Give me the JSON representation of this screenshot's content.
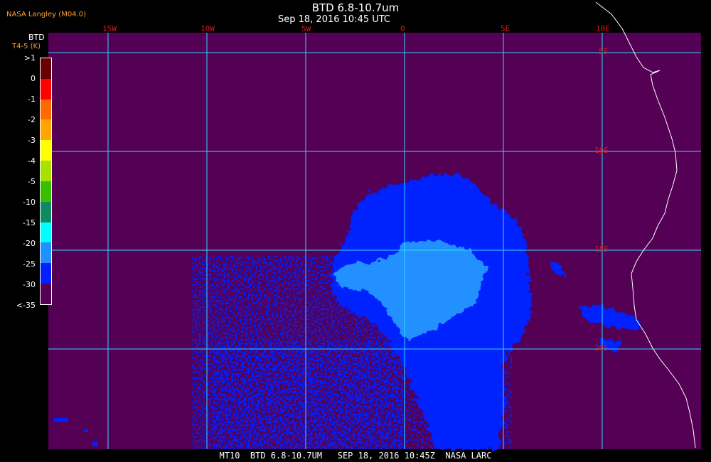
{
  "header": {
    "title": "BTD 6.8-10.7um",
    "subtitle": "Sep 18, 2016 10:45 UTC",
    "org": "NASA Langley (M04.0)"
  },
  "colorbar": {
    "title": "BTD",
    "units": "T4-5 (K)",
    "labels": [
      ">1",
      "0",
      "-1",
      "-2",
      "-3",
      "-4",
      "-5",
      "-10",
      "-15",
      "-20",
      "-25",
      "-30",
      "<-35"
    ],
    "colors": [
      "#6b0000",
      "#ff0000",
      "#ff6a00",
      "#ffa500",
      "#ffff00",
      "#a8e000",
      "#38c000",
      "#108a60",
      "#00ffff",
      "#2090ff",
      "#0020ff",
      "#540054"
    ]
  },
  "map": {
    "background_color": "#540054",
    "grid_color": "#33d6ff",
    "coast_color": "#ffffff",
    "lon_labels": [
      "15W",
      "10W",
      "5W",
      "0",
      "5E",
      "10E"
    ],
    "lat_labels": [
      "5S",
      "10S",
      "15S",
      "20S"
    ]
  },
  "footer": {
    "text": "MT10  BTD 6.8-10.7UM   SEP 18, 2016 10:45Z  NASA LARC"
  }
}
